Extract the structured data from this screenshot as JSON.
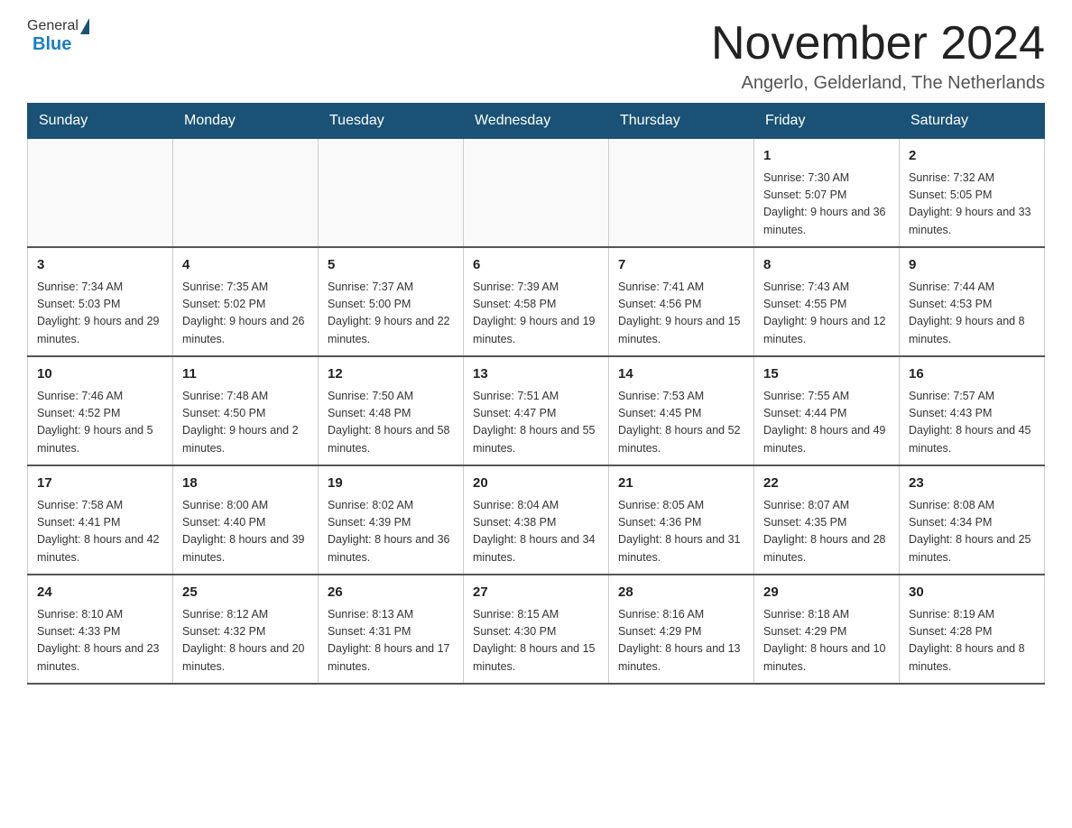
{
  "header": {
    "title": "November 2024",
    "location": "Angerlo, Gelderland, The Netherlands",
    "logo_general": "General",
    "logo_blue": "Blue"
  },
  "weekdays": [
    "Sunday",
    "Monday",
    "Tuesday",
    "Wednesday",
    "Thursday",
    "Friday",
    "Saturday"
  ],
  "weeks": [
    [
      {
        "day": "",
        "info": ""
      },
      {
        "day": "",
        "info": ""
      },
      {
        "day": "",
        "info": ""
      },
      {
        "day": "",
        "info": ""
      },
      {
        "day": "",
        "info": ""
      },
      {
        "day": "1",
        "info": "Sunrise: 7:30 AM\nSunset: 5:07 PM\nDaylight: 9 hours\nand 36 minutes."
      },
      {
        "day": "2",
        "info": "Sunrise: 7:32 AM\nSunset: 5:05 PM\nDaylight: 9 hours\nand 33 minutes."
      }
    ],
    [
      {
        "day": "3",
        "info": "Sunrise: 7:34 AM\nSunset: 5:03 PM\nDaylight: 9 hours\nand 29 minutes."
      },
      {
        "day": "4",
        "info": "Sunrise: 7:35 AM\nSunset: 5:02 PM\nDaylight: 9 hours\nand 26 minutes."
      },
      {
        "day": "5",
        "info": "Sunrise: 7:37 AM\nSunset: 5:00 PM\nDaylight: 9 hours\nand 22 minutes."
      },
      {
        "day": "6",
        "info": "Sunrise: 7:39 AM\nSunset: 4:58 PM\nDaylight: 9 hours\nand 19 minutes."
      },
      {
        "day": "7",
        "info": "Sunrise: 7:41 AM\nSunset: 4:56 PM\nDaylight: 9 hours\nand 15 minutes."
      },
      {
        "day": "8",
        "info": "Sunrise: 7:43 AM\nSunset: 4:55 PM\nDaylight: 9 hours\nand 12 minutes."
      },
      {
        "day": "9",
        "info": "Sunrise: 7:44 AM\nSunset: 4:53 PM\nDaylight: 9 hours\nand 8 minutes."
      }
    ],
    [
      {
        "day": "10",
        "info": "Sunrise: 7:46 AM\nSunset: 4:52 PM\nDaylight: 9 hours\nand 5 minutes."
      },
      {
        "day": "11",
        "info": "Sunrise: 7:48 AM\nSunset: 4:50 PM\nDaylight: 9 hours\nand 2 minutes."
      },
      {
        "day": "12",
        "info": "Sunrise: 7:50 AM\nSunset: 4:48 PM\nDaylight: 8 hours\nand 58 minutes."
      },
      {
        "day": "13",
        "info": "Sunrise: 7:51 AM\nSunset: 4:47 PM\nDaylight: 8 hours\nand 55 minutes."
      },
      {
        "day": "14",
        "info": "Sunrise: 7:53 AM\nSunset: 4:45 PM\nDaylight: 8 hours\nand 52 minutes."
      },
      {
        "day": "15",
        "info": "Sunrise: 7:55 AM\nSunset: 4:44 PM\nDaylight: 8 hours\nand 49 minutes."
      },
      {
        "day": "16",
        "info": "Sunrise: 7:57 AM\nSunset: 4:43 PM\nDaylight: 8 hours\nand 45 minutes."
      }
    ],
    [
      {
        "day": "17",
        "info": "Sunrise: 7:58 AM\nSunset: 4:41 PM\nDaylight: 8 hours\nand 42 minutes."
      },
      {
        "day": "18",
        "info": "Sunrise: 8:00 AM\nSunset: 4:40 PM\nDaylight: 8 hours\nand 39 minutes."
      },
      {
        "day": "19",
        "info": "Sunrise: 8:02 AM\nSunset: 4:39 PM\nDaylight: 8 hours\nand 36 minutes."
      },
      {
        "day": "20",
        "info": "Sunrise: 8:04 AM\nSunset: 4:38 PM\nDaylight: 8 hours\nand 34 minutes."
      },
      {
        "day": "21",
        "info": "Sunrise: 8:05 AM\nSunset: 4:36 PM\nDaylight: 8 hours\nand 31 minutes."
      },
      {
        "day": "22",
        "info": "Sunrise: 8:07 AM\nSunset: 4:35 PM\nDaylight: 8 hours\nand 28 minutes."
      },
      {
        "day": "23",
        "info": "Sunrise: 8:08 AM\nSunset: 4:34 PM\nDaylight: 8 hours\nand 25 minutes."
      }
    ],
    [
      {
        "day": "24",
        "info": "Sunrise: 8:10 AM\nSunset: 4:33 PM\nDaylight: 8 hours\nand 23 minutes."
      },
      {
        "day": "25",
        "info": "Sunrise: 8:12 AM\nSunset: 4:32 PM\nDaylight: 8 hours\nand 20 minutes."
      },
      {
        "day": "26",
        "info": "Sunrise: 8:13 AM\nSunset: 4:31 PM\nDaylight: 8 hours\nand 17 minutes."
      },
      {
        "day": "27",
        "info": "Sunrise: 8:15 AM\nSunset: 4:30 PM\nDaylight: 8 hours\nand 15 minutes."
      },
      {
        "day": "28",
        "info": "Sunrise: 8:16 AM\nSunset: 4:29 PM\nDaylight: 8 hours\nand 13 minutes."
      },
      {
        "day": "29",
        "info": "Sunrise: 8:18 AM\nSunset: 4:29 PM\nDaylight: 8 hours\nand 10 minutes."
      },
      {
        "day": "30",
        "info": "Sunrise: 8:19 AM\nSunset: 4:28 PM\nDaylight: 8 hours\nand 8 minutes."
      }
    ]
  ]
}
